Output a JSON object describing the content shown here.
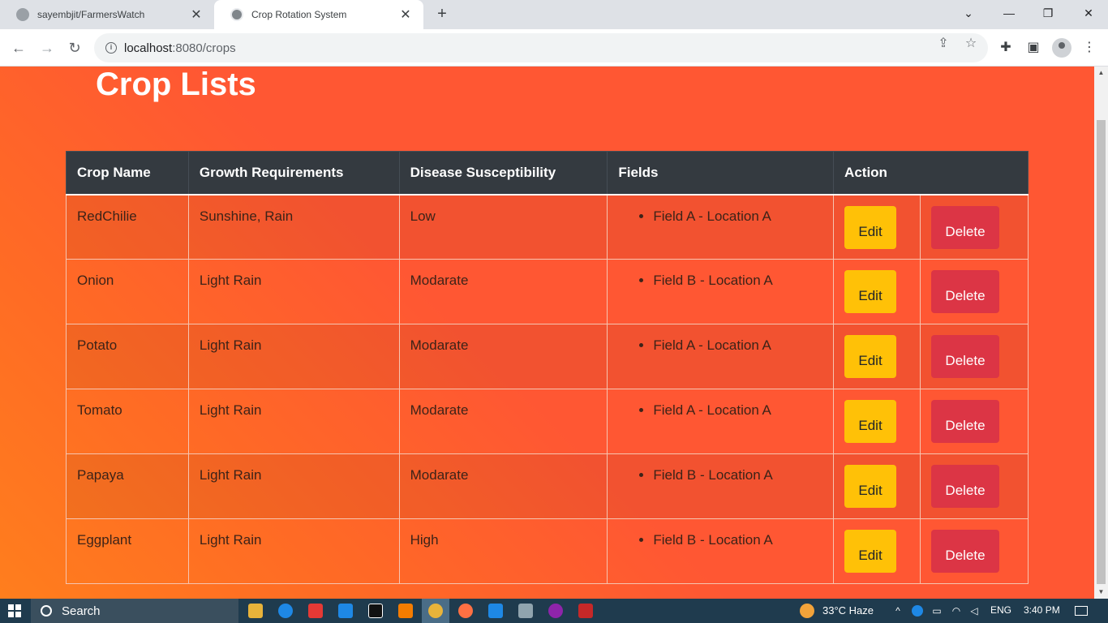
{
  "browser": {
    "tabs": [
      {
        "title": "sayembjit/FarmersWatch",
        "active": false
      },
      {
        "title": "Crop Rotation System",
        "active": true
      }
    ],
    "url_host": "localhost",
    "url_path": ":8080/crops"
  },
  "page": {
    "title": "Crop Lists",
    "table": {
      "headers": [
        "Crop Name",
        "Growth Requirements",
        "Disease Susceptibility",
        "Fields",
        "Action"
      ],
      "rows": [
        {
          "name": "RedChilie",
          "growth": "Sunshine, Rain",
          "disease": "Low",
          "fields": [
            "Field A - Location A"
          ]
        },
        {
          "name": "Onion",
          "growth": "Light Rain",
          "disease": "Modarate",
          "fields": [
            "Field B - Location A"
          ]
        },
        {
          "name": "Potato",
          "growth": "Light Rain",
          "disease": "Modarate",
          "fields": [
            "Field A - Location A"
          ]
        },
        {
          "name": "Tomato",
          "growth": "Light Rain",
          "disease": "Modarate",
          "fields": [
            "Field A - Location A"
          ]
        },
        {
          "name": "Papaya",
          "growth": "Light Rain",
          "disease": "Modarate",
          "fields": [
            "Field B - Location A"
          ]
        },
        {
          "name": "Eggplant",
          "growth": "Light Rain",
          "disease": "High",
          "fields": [
            "Field B - Location A"
          ]
        }
      ],
      "edit_label": "Edit",
      "delete_label": "Delete"
    },
    "colors": {
      "background": "#ff5733",
      "header_bg": "#343a40",
      "edit_button": "#ffc107",
      "delete_button": "#dc3545"
    }
  },
  "taskbar": {
    "search_placeholder": "Search",
    "weather": "33°C  Haze",
    "language": "ENG",
    "time": "3:40 PM"
  }
}
